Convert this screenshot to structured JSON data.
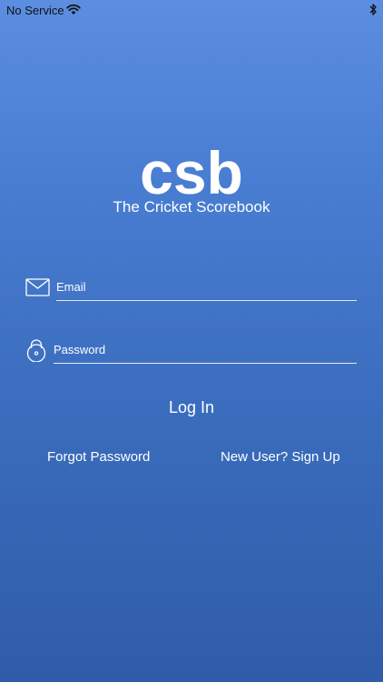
{
  "status_bar": {
    "carrier": "No Service",
    "wifi_icon": "wifi-icon",
    "bluetooth_icon": "bluetooth-icon"
  },
  "brand": {
    "logo": "csb",
    "tagline": "The Cricket Scorebook"
  },
  "form": {
    "email_placeholder": "Email",
    "email_value": "",
    "email_icon": "envelope-icon",
    "password_placeholder": "Password",
    "password_value": "",
    "password_icon": "lock-icon",
    "login_label": "Log In"
  },
  "links": {
    "forgot_password": "Forgot Password",
    "sign_up": "New User? Sign Up"
  },
  "colors": {
    "background_top": "#5b8ee0",
    "background_bottom": "#2f5ca8",
    "text": "#ffffff"
  }
}
